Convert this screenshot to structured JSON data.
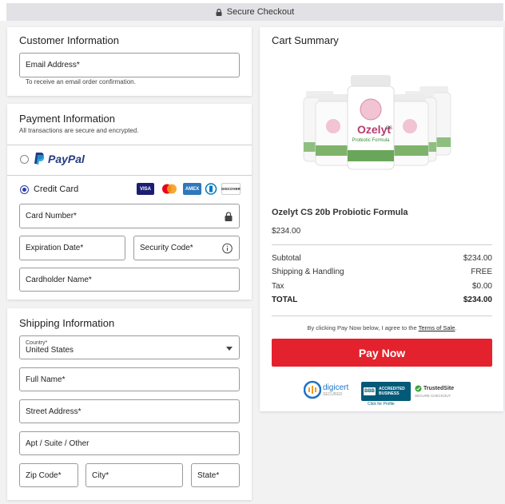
{
  "topbar": {
    "label": "Secure Checkout",
    "icon": "lock-icon"
  },
  "customer": {
    "heading": "Customer Information",
    "email_placeholder": "Email Address*",
    "email_hint": "To receive an email order confirmation."
  },
  "payment": {
    "heading": "Payment Information",
    "subheading": "All transactions are secure and encrypted.",
    "paypal_label": "PayPal",
    "paypal_selected": false,
    "credit_label": "Credit Card",
    "credit_selected": true,
    "card_brands": [
      "VISA",
      "mastercard",
      "AMEX",
      "diners",
      "DISCOVER"
    ],
    "card_number_placeholder": "Card Number*",
    "expiration_placeholder": "Expiration Date*",
    "security_placeholder": "Security Code*",
    "cardholder_placeholder": "Cardholder Name*"
  },
  "shipping": {
    "heading": "Shipping Information",
    "country_label": "Country*",
    "country_value": "United States",
    "full_name_placeholder": "Full Name*",
    "street_placeholder": "Street Address*",
    "apt_placeholder": "Apt / Suite / Other",
    "zip_placeholder": "Zip Code*",
    "city_placeholder": "City*",
    "state_placeholder": "State*"
  },
  "summary": {
    "heading": "Cart Summary",
    "product_name": "Ozelyt CS 20b Probiotic Formula",
    "product_price": "$234.00",
    "bottle_brand": "Ozelyt",
    "bottle_suffix": "CS",
    "bottle_subtitle": "Probiotic Formula",
    "rows": [
      {
        "label": "Subtotal",
        "value": "$234.00",
        "bold": false
      },
      {
        "label": "Shipping & Handling",
        "value": "FREE",
        "bold": false
      },
      {
        "label": "Tax",
        "value": "$0.00",
        "bold": false
      },
      {
        "label": "TOTAL",
        "value": "$234.00",
        "bold": true
      }
    ],
    "terms_text": "By clicking Pay Now below, I agree to the",
    "terms_link": "Terms of Sale",
    "terms_end": ".",
    "pay_button": "Pay Now",
    "badges": {
      "digicert": "digicert",
      "digicert_sub": "SECURED",
      "bbb_line1": "ACCREDITED",
      "bbb_line2": "BUSINESS",
      "bbb_sub": "Click for Profile",
      "bbb_logo": "BBB",
      "trusted": "TrustedSite",
      "trusted_sub": "SECURE CHECKOUT"
    }
  },
  "colors": {
    "accent": "#e3222d",
    "paypal_dark": "#253b80",
    "paypal_light": "#179bd7",
    "radio": "#2c3fa8",
    "bbb_blue": "#005a78"
  }
}
